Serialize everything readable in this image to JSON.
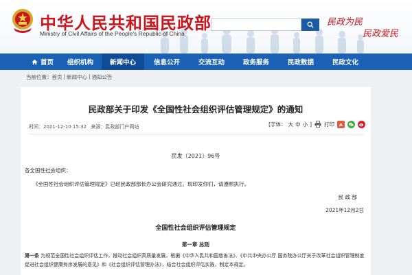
{
  "header": {
    "title_cn": "中华人民共和国民政部",
    "title_en": "Ministry of Civil Affairs of the People's Republic of China",
    "search_placeholder": "",
    "slogan_line1": "民政为民",
    "slogan_line2": "民政爱民"
  },
  "nav": {
    "items": [
      {
        "label": "首页"
      },
      {
        "label": "组织机构"
      },
      {
        "label": "新闻中心"
      },
      {
        "label": "信息公开"
      },
      {
        "label": "交流互动"
      },
      {
        "label": "政务服务"
      },
      {
        "label": "民政数据"
      },
      {
        "label": "民政文化"
      }
    ],
    "active_index": 2
  },
  "breadcrumb": {
    "prefix": "当前位置：",
    "items": [
      "首页",
      "新闻中心",
      "通知公告"
    ]
  },
  "article": {
    "title": "民政部关于印发《全国性社会组织评估管理规定》的通知",
    "time": "时间：2021-12-10 15:32",
    "source_label": "来源：",
    "source": "民政部门户网站",
    "font_size_label": "[字体：",
    "font_large": "大",
    "font_medium": "中",
    "font_small": "小",
    "font_close": "]",
    "print_label": "打印",
    "doc_number": "民发〔2021〕96号",
    "recipient": "各全国性社会组织：",
    "body": "《全国性社会组织评估管理规定》已经民政部部长办公会研究通过。现印发你们，请遵照执行。",
    "signature": "民 政 部",
    "date": "2021年12月2日",
    "sub_title": "全国性社会组织评估管理规定",
    "chapter": "第一章 总则",
    "art1_label": "第一条",
    "art1_text": " 为规范全国性社会组织评估工作，推动社会组织高质量发展，根据《中华人民共和国慈善法》、《中共中央办公厅 国务院办公厅关于改革社会组织管理制度 促进社会组织健康有序发展的意见》和《社会组织评估管理办法》，结合社会组织评估实践，制定本规定。"
  },
  "colors": {
    "brand_red": "#c8161d",
    "nav_blue": "#1b62b6",
    "nav_active": "#0f4c95"
  }
}
